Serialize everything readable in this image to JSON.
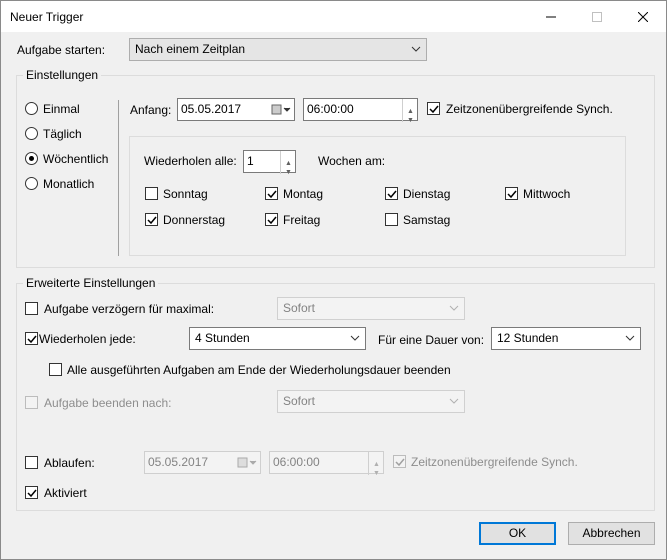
{
  "window": {
    "title": "Neuer Trigger"
  },
  "start_task": {
    "label": "Aufgabe starten:",
    "value": "Nach einem Zeitplan"
  },
  "settings": {
    "group_title": "Einstellungen",
    "schedule_types": [
      "Einmal",
      "Täglich",
      "Wöchentlich",
      "Monatlich"
    ],
    "selected": "Wöchentlich",
    "start_label": "Anfang:",
    "start_date": "05.05.2017",
    "start_time": "06:00:00",
    "sync_label": "Zeitzonenübergreifende Synch.",
    "sync_checked": true,
    "repeat_every_label": "Wiederholen alle:",
    "repeat_every_value": "1",
    "weeks_on_label": "Wochen am:",
    "days": {
      "sonntag": {
        "label": "Sonntag",
        "checked": false
      },
      "montag": {
        "label": "Montag",
        "checked": true
      },
      "dienstag": {
        "label": "Dienstag",
        "checked": true
      },
      "mittwoch": {
        "label": "Mittwoch",
        "checked": true
      },
      "donnerstag": {
        "label": "Donnerstag",
        "checked": true
      },
      "freitag": {
        "label": "Freitag",
        "checked": true
      },
      "samstag": {
        "label": "Samstag",
        "checked": false
      }
    }
  },
  "advanced": {
    "group_title": "Erweiterte Einstellungen",
    "delay_label": "Aufgabe verzögern für maximal:",
    "delay_checked": false,
    "delay_value": "Sofort",
    "repeat_label": "Wiederholen jede:",
    "repeat_checked": true,
    "repeat_value": "4 Stunden",
    "duration_label": "Für eine Dauer von:",
    "duration_value": "12 Stunden",
    "stop_all_label": "Alle ausgeführten Aufgaben am Ende der Wiederholungsdauer beenden",
    "stop_all_checked": false,
    "stop_after_label": "Aufgabe beenden nach:",
    "stop_after_checked": false,
    "stop_after_value": "Sofort",
    "expire_label": "Ablaufen:",
    "expire_checked": false,
    "expire_date": "05.05.2017",
    "expire_time": "06:00:00",
    "expire_sync_label": "Zeitzonenübergreifende Synch.",
    "expire_sync_checked": true,
    "enabled_label": "Aktiviert",
    "enabled_checked": true
  },
  "buttons": {
    "ok": "OK",
    "cancel": "Abbrechen"
  }
}
